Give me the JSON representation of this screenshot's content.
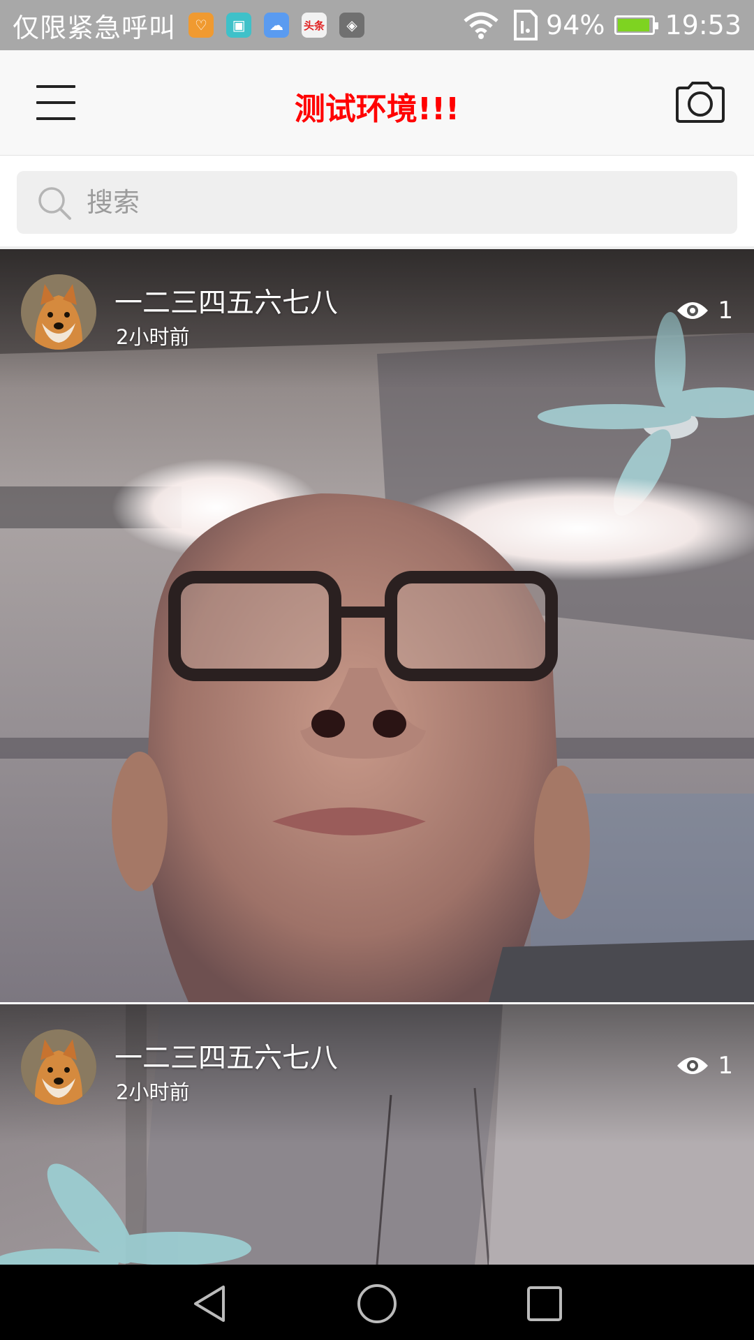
{
  "status_bar": {
    "carrier": "仅限紧急呼叫",
    "apps": [
      {
        "icon": "health-app-icon",
        "color": "#f09a30",
        "glyph": "♡"
      },
      {
        "icon": "android-app-icon",
        "color": "#3fc1c9",
        "glyph": "▣"
      },
      {
        "icon": "cloud-app-icon",
        "color": "#5a9bf0",
        "glyph": "☁"
      },
      {
        "icon": "toutiao-app-icon",
        "color": "#e8e8e8",
        "glyph": "头条"
      },
      {
        "icon": "shield-app-icon",
        "color": "#7a7a7a",
        "glyph": "◈"
      }
    ],
    "battery_percent": "94%",
    "battery_level": 0.94,
    "time": "19:53"
  },
  "title_bar": {
    "title": "测试环境!!!",
    "title_color": "#ff0000",
    "menu_icon": "hamburger-menu-icon",
    "camera_icon": "camera-icon"
  },
  "search": {
    "placeholder": "搜索",
    "value": ""
  },
  "feed": {
    "posts": [
      {
        "author": "一二三四五六七八",
        "time_ago": "2小时前",
        "views": "1"
      },
      {
        "author": "一二三四五六七八",
        "time_ago": "2小时前",
        "views": "1"
      }
    ]
  },
  "nav_bar": {
    "icons": [
      "back-icon",
      "home-icon",
      "recents-icon"
    ]
  }
}
